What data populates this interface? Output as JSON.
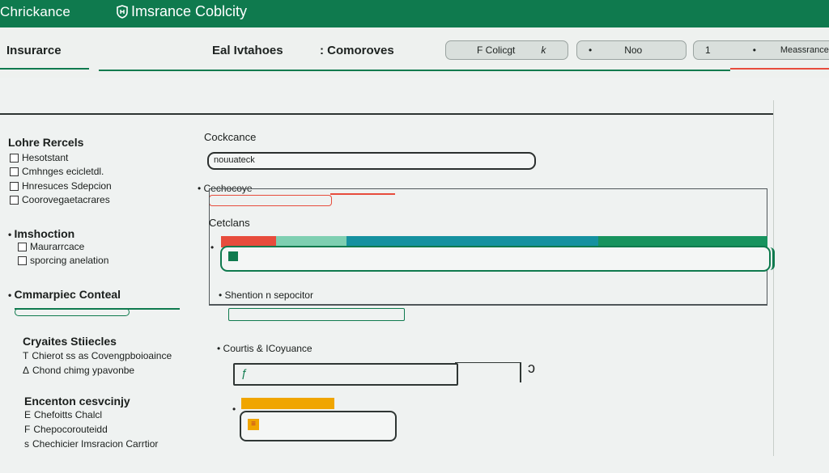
{
  "topbar": {
    "app_title": "Chrickance",
    "brand_title": "Imsrance Coblcity"
  },
  "header": {
    "title": "Insurarce",
    "tab1": "Eal Ivtahoes",
    "tab2": ": Comoroves",
    "pill1_label": "F Colicgt",
    "pill1_icon_char": "k",
    "pill2_label": "Noo",
    "pill3_label": "Meassrance",
    "pill3_marker": "1"
  },
  "sidebar": {
    "section1": {
      "title": "Lohre Rercels",
      "items": [
        "Hesotstant",
        "Cmhnges ecicletdl.",
        "Hnresuces Sdepcion",
        "Coorovegaetacrares"
      ]
    },
    "section2": {
      "title": "Imshoction",
      "items": [
        "Maurarrcace",
        "sporcing anelation"
      ]
    },
    "section3": {
      "title": "Cmmarpiec Conteal"
    },
    "section4": {
      "title": "Cryaites Stiiecles",
      "items": [
        "Chierot ss as Covengpboioaince",
        "Chond chimg ypavonbe"
      ],
      "markers": [
        "T",
        "Δ"
      ]
    },
    "section5": {
      "title": "Encenton cesvcinjy",
      "items": [
        "Chefoitts Chalcl",
        "Chepocorouteidd",
        "Chechicier Imsracion Carrtior"
      ],
      "markers": [
        "E",
        "F",
        "s"
      ]
    }
  },
  "main": {
    "label1": "Cockcance",
    "field1_value": "nouuateck",
    "label2": "Cechocoye",
    "label3": "Cetclans",
    "label4": "Shention n sepocitor",
    "label5": "Courtis & ICoyuance",
    "field3_icon_char": "ƒ",
    "field4_icon_char": "≡"
  },
  "progress": {
    "segments": [
      {
        "color": "#e74c3c",
        "fraction": 0.1
      },
      {
        "color": "#7ecfb1",
        "fraction": 0.13
      },
      {
        "color": "#1591a0",
        "fraction": 0.46
      },
      {
        "color": "#17935e",
        "fraction": 0.31
      }
    ]
  },
  "colors": {
    "brand": "#0f7a4e",
    "accent_red": "#e74c3c",
    "accent_amber": "#f0a500"
  }
}
